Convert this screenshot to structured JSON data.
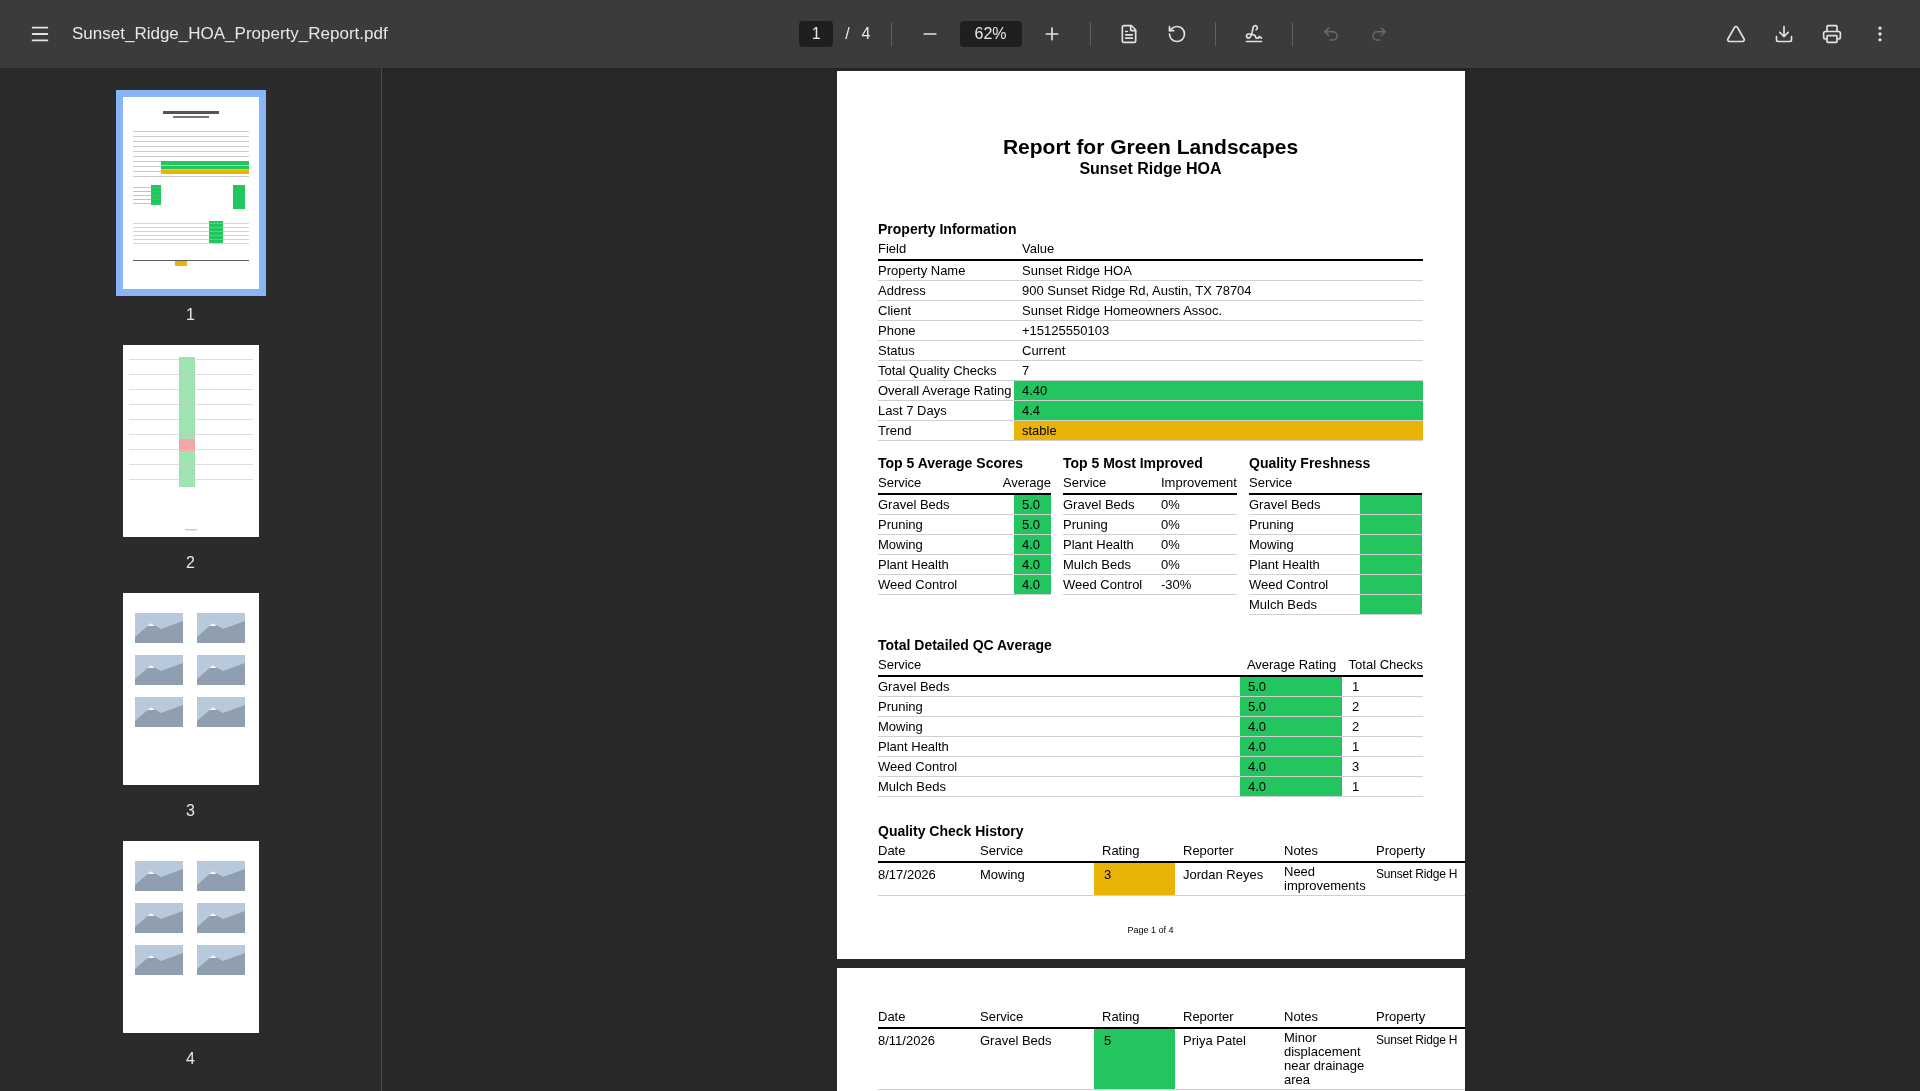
{
  "toolbar": {
    "title": "Sunset_Ridge_HOA_Property_Report.pdf",
    "page_current": "1",
    "page_separator": "/",
    "page_total": "4",
    "zoom": "62%",
    "undo_disabled": true,
    "redo_disabled": true
  },
  "thumbnails": [
    {
      "label": "1",
      "selected": true,
      "kind": "report"
    },
    {
      "label": "2",
      "selected": false,
      "kind": "table"
    },
    {
      "label": "3",
      "selected": false,
      "kind": "gallery"
    },
    {
      "label": "4",
      "selected": false,
      "kind": "gallery"
    }
  ],
  "page1": {
    "title": "Report for Green Landscapes",
    "subtitle": "Sunset Ridge HOA",
    "property_info": {
      "heading": "Property Information",
      "columns": [
        "Field",
        "Value"
      ],
      "rows": [
        {
          "field": "Property Name",
          "value": "Sunset Ridge HOA"
        },
        {
          "field": "Address",
          "value": "900 Sunset Ridge Rd, Austin, TX 78704"
        },
        {
          "field": "Client",
          "value": "Sunset Ridge Homeowners Assoc."
        },
        {
          "field": "Phone",
          "value": "+15125550103"
        },
        {
          "field": "Status",
          "value": "Current"
        },
        {
          "field": "Total Quality Checks",
          "value": "7"
        },
        {
          "field": "Overall Average Rating",
          "value": "4.40",
          "color": "#22c55e"
        },
        {
          "field": "Last 7 Days",
          "value": "4.4",
          "color": "#22c55e"
        },
        {
          "field": "Trend",
          "value": "stable",
          "color": "#eab308"
        }
      ]
    },
    "top_average": {
      "heading": "Top 5 Average Scores",
      "columns": [
        "Service",
        "Average"
      ],
      "rows": [
        {
          "service": "Gravel Beds",
          "value": "5.0",
          "color": "#22c55e"
        },
        {
          "service": "Pruning",
          "value": "5.0",
          "color": "#22c55e"
        },
        {
          "service": "Mowing",
          "value": "4.0",
          "color": "#22c55e"
        },
        {
          "service": "Plant Health",
          "value": "4.0",
          "color": "#22c55e"
        },
        {
          "service": "Weed Control",
          "value": "4.0",
          "color": "#22c55e"
        }
      ]
    },
    "most_improved": {
      "heading": "Top 5 Most Improved",
      "columns": [
        "Service",
        "Improvement"
      ],
      "rows": [
        {
          "service": "Gravel Beds",
          "value": "0%"
        },
        {
          "service": "Pruning",
          "value": "0%"
        },
        {
          "service": "Plant Health",
          "value": "0%"
        },
        {
          "service": "Mulch Beds",
          "value": "0%"
        },
        {
          "service": "Weed Control",
          "value": "-30%"
        }
      ]
    },
    "freshness": {
      "heading": "Quality Freshness",
      "columns": [
        "Service"
      ],
      "rows": [
        {
          "service": "Gravel Beds",
          "color": "#22c55e"
        },
        {
          "service": "Pruning",
          "color": "#22c55e"
        },
        {
          "service": "Mowing",
          "color": "#22c55e"
        },
        {
          "service": "Plant Health",
          "color": "#22c55e"
        },
        {
          "service": "Weed Control",
          "color": "#22c55e"
        },
        {
          "service": "Mulch Beds",
          "color": "#22c55e"
        }
      ]
    },
    "qc_average": {
      "heading": "Total Detailed QC Average",
      "columns": [
        "Service",
        "Average Rating",
        "Total Checks"
      ],
      "rows": [
        {
          "service": "Gravel Beds",
          "rating": "5.0",
          "color": "#22c55e",
          "checks": "1"
        },
        {
          "service": "Pruning",
          "rating": "5.0",
          "color": "#22c55e",
          "checks": "2"
        },
        {
          "service": "Mowing",
          "rating": "4.0",
          "color": "#22c55e",
          "checks": "2"
        },
        {
          "service": "Plant Health",
          "rating": "4.0",
          "color": "#22c55e",
          "checks": "1"
        },
        {
          "service": "Weed Control",
          "rating": "4.0",
          "color": "#22c55e",
          "checks": "3"
        },
        {
          "service": "Mulch Beds",
          "rating": "4.0",
          "color": "#22c55e",
          "checks": "1"
        }
      ]
    },
    "history": {
      "heading": "Quality Check History",
      "columns": [
        "Date",
        "Service",
        "Rating",
        "Reporter",
        "Notes",
        "Property"
      ],
      "rows": [
        {
          "date": "8/17/2026",
          "service": "Mowing",
          "rating": "3",
          "color": "#eab308",
          "reporter": "Jordan Reyes",
          "notes": "Need improvements",
          "property": "Sunset Ridge H"
        }
      ]
    },
    "footer": "Page 1 of 4"
  },
  "page2": {
    "columns": [
      "Date",
      "Service",
      "Rating",
      "Reporter",
      "Notes",
      "Property"
    ],
    "rows": [
      {
        "date": "8/11/2026",
        "service": "Gravel Beds",
        "rating": "5",
        "color": "#22c55e",
        "reporter": "Priya Patel",
        "notes": "Minor displacement near drainage area",
        "property": "Sunset Ridge H"
      }
    ]
  }
}
